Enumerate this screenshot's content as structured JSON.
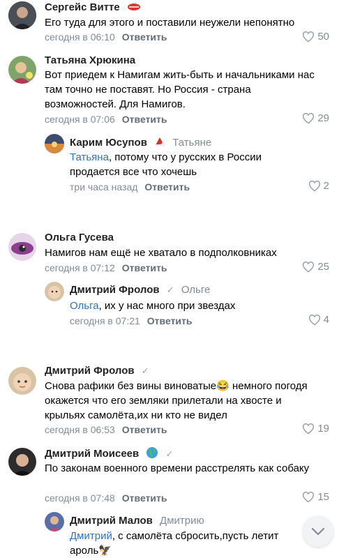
{
  "reply_label": "Ответить",
  "comments": [
    {
      "author": "Сергейс Витте",
      "text": "Его туда для этого и поставили неужели непонятно",
      "time": "сегодня в 06:10",
      "likes": "50"
    },
    {
      "author": "Татьяна Хрюкина",
      "text": "Вот приедем к Намигам жить-быть и начальниками нас там точно не поставят. Но Россия - страна возможностей. Для Намигов.",
      "time": "сегодня в 07:06",
      "likes": "29"
    },
    {
      "author": "Карим Юсупов",
      "reply_to": "Татьяне",
      "mention": "Татьяна",
      "text": ", потому что у русских в России продается все что хочешь",
      "time": "три часа назад",
      "likes": "2"
    },
    {
      "author": "Ольга Гусева",
      "text": "Намигов нам ещё не хватало в подполковниках",
      "time": "сегодня в 07:12",
      "likes": "25"
    },
    {
      "author": "Дмитрий Фролов",
      "reply_to": "Ольге",
      "mention": "Ольга",
      "text": ", их у нас много при звездах",
      "time": "сегодня в 07:21",
      "likes": "4"
    },
    {
      "author": "Дмитрий Фролов",
      "text": "Снова рафики без вины виноватые😂 немного погодя окажется что его земляки прилетали на хвосте и крыльях самолёта,их ни кто не видел",
      "time": "сегодня в 06:53",
      "likes": "19"
    },
    {
      "author": "Дмитрий Моисеев",
      "text": "По законам военного времени расстрелять как собаку",
      "time": "сегодня в 07:48",
      "likes": "15"
    },
    {
      "author": "Дмитрий Малов",
      "reply_to": "Дмитрию",
      "mention": "Дмитрий",
      "text": ", с самолёта сбросить,пусть летит ароль🦅"
    }
  ],
  "icons": {
    "like": "heart-icon",
    "scroll": "chevron-down-icon",
    "verified": "check-icon"
  },
  "colors": {
    "link": "#2a75c9",
    "secondary": "#818c99"
  }
}
